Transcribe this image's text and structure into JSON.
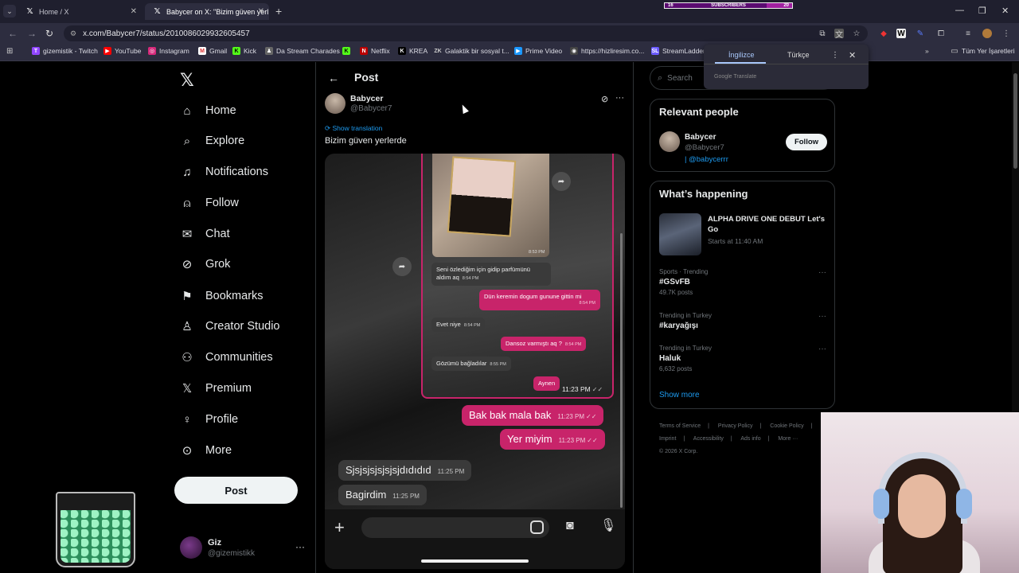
{
  "browser": {
    "tabs": [
      {
        "title": "Home / X"
      },
      {
        "title": "Babycer on X: \"Bizim güven yerl"
      }
    ],
    "url": "x.com/Babycer7/status/2010086029932605457",
    "bookmarks": [
      "gizemistik - Twitch",
      "YouTube",
      "Instagram",
      "Gmail",
      "Kick",
      "Da Stream Charades",
      "",
      "Netflix",
      "KREA",
      "Galaktik bir sosyal t...",
      "Prime Video",
      "https://hizliresim.co...",
      "StreamLadder"
    ],
    "bookmarks_folder": "Tüm Yer İşaretleri",
    "overlay_subscribers": {
      "label": "SUBSCRIBERS",
      "current": "16",
      "goal": "20",
      "progress": 0.8
    }
  },
  "translate_popup": {
    "lang_from": "İngilizce",
    "lang_to": "Türkçe",
    "brand": "Google Translate"
  },
  "nav": {
    "items": [
      "Home",
      "Explore",
      "Notifications",
      "Follow",
      "Chat",
      "Grok",
      "Bookmarks",
      "Creator Studio",
      "Communities",
      "Premium",
      "Profile",
      "More"
    ],
    "post_button": "Post",
    "account": {
      "name": "Giz",
      "handle": "@gizemistikk"
    }
  },
  "post": {
    "header": "Post",
    "author_name": "Babycer",
    "author_handle": "@Babycer7",
    "show_translation": "Show translation",
    "text": "Bizim güven yerlerde",
    "media": {
      "perfume_time": "8:53 PM",
      "inner_messages": [
        {
          "dir": "in",
          "text": "Seni özlediğim için gidip parfümünü aldım aq",
          "time": "8:54 PM"
        },
        {
          "dir": "out",
          "text": "Dün keremin dogum gunune gittin mi",
          "time": "8:54 PM"
        },
        {
          "dir": "in",
          "text": "Evet niye",
          "time": "8:54 PM"
        },
        {
          "dir": "out",
          "text": "Dansoz varmıştı aq ?",
          "time": "8:54 PM"
        },
        {
          "dir": "in",
          "text": "Gözümü bağladılar",
          "time": "8:55 PM"
        },
        {
          "dir": "out",
          "text": "Aynen",
          "time": "11:23 PM"
        }
      ],
      "outer_messages": [
        {
          "dir": "out",
          "text": "Bak bak mala bak",
          "time": "11:23 PM"
        },
        {
          "dir": "out",
          "text": "Yer miyim",
          "time": "11:23 PM"
        },
        {
          "dir": "in",
          "text": "Sjsjsjsjsjsjsjdıdıdıd",
          "time": "11:25 PM"
        },
        {
          "dir": "in",
          "text": "Bagirdim",
          "time": "11:25 PM"
        }
      ]
    }
  },
  "right": {
    "search_placeholder": "Search",
    "relevant": {
      "title": "Relevant people",
      "name": "Babycer",
      "handle": "@Babycer7",
      "bio": "| @babycerrr",
      "follow": "Follow"
    },
    "happening": {
      "title": "What’s happening",
      "event": {
        "title": "ALPHA DRIVE ONE DEBUT Let's Go",
        "time": "Starts at 11:40 AM"
      },
      "trends": [
        {
          "context": "Sports · Trending",
          "name": "#GSvFB",
          "posts": "49.7K posts"
        },
        {
          "context": "Trending in Turkey",
          "name": "#karyağışı",
          "posts": ""
        },
        {
          "context": "Trending in Turkey",
          "name": "Haluk",
          "posts": "6,632 posts"
        }
      ],
      "show_more": "Show more"
    },
    "footer": [
      "Terms of Service",
      "|",
      "Privacy Policy",
      "|",
      "Cookie Policy",
      "|",
      "Imprint",
      "|",
      "Accessibility",
      "|",
      "Ads info",
      "|",
      "More ···",
      "© 2026 X Corp."
    ]
  }
}
